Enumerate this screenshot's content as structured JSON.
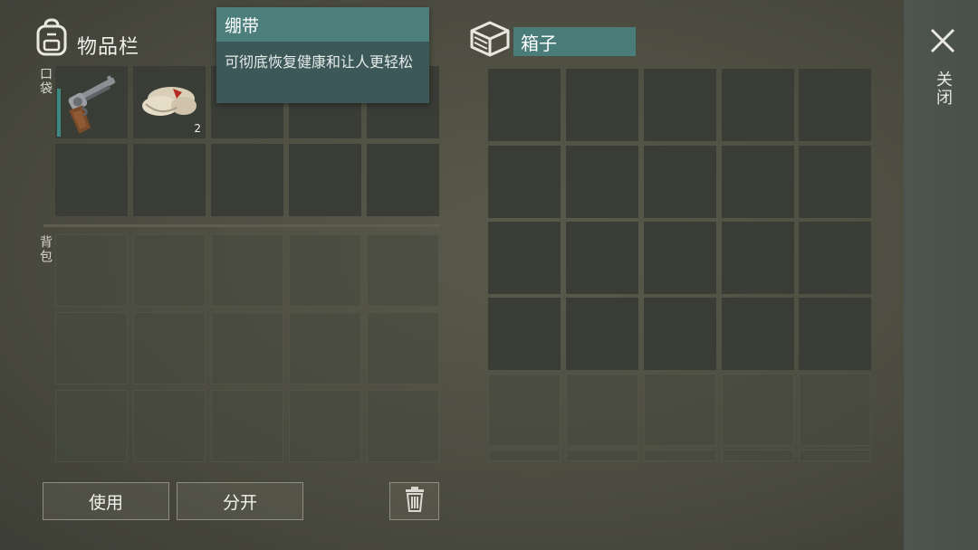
{
  "inventory": {
    "title": "物品栏",
    "pocket_label": "口袋",
    "backpack_label": "背包"
  },
  "items": {
    "revolver": {
      "name": "revolver",
      "durability": 0.75
    },
    "bandage": {
      "name": "bandage",
      "count": "2"
    }
  },
  "tooltip": {
    "title": "绷带",
    "description": "可彻底恢复健康和让人更轻松"
  },
  "box": {
    "title": "箱子"
  },
  "close": {
    "label": "关闭"
  },
  "actions": {
    "use": "使用",
    "split": "分开"
  },
  "colors": {
    "accent": "#4c7e7c",
    "slot": "#3a3c36",
    "background": "#4c4c40"
  }
}
